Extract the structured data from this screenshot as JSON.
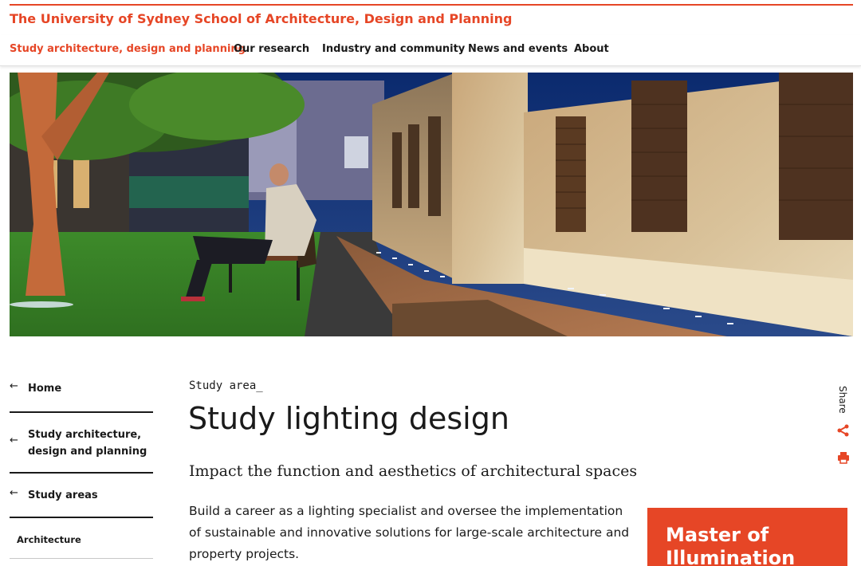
{
  "site": {
    "title": "The University of Sydney School of Architecture, Design and Planning"
  },
  "nav": {
    "items": [
      {
        "label": "Study architecture, design and planning"
      },
      {
        "label": "Our research"
      },
      {
        "label": "Industry and community"
      },
      {
        "label": "News and events"
      },
      {
        "label": "About"
      }
    ]
  },
  "sidebar": {
    "items": [
      {
        "label": "Home"
      },
      {
        "label": "Study architecture, design and planning"
      },
      {
        "label": "Study areas"
      },
      {
        "label": "Architecture"
      }
    ]
  },
  "main": {
    "eyebrow": "Study area_",
    "title": "Study lighting design",
    "subtitle": "Impact the function and aesthetics of architectural spaces",
    "intro": "Build a career as a lighting specialist and oversee the implementation of sustainable and innovative solutions for large-scale architecture and property projects."
  },
  "share": {
    "label": "Share"
  },
  "promo": {
    "title": "Master of Illumination"
  },
  "colors": {
    "accent": "#e64626",
    "text": "#1a1a1a"
  },
  "icons": {
    "back": "arrow-left-icon",
    "share": "share-icon",
    "print": "print-icon"
  }
}
